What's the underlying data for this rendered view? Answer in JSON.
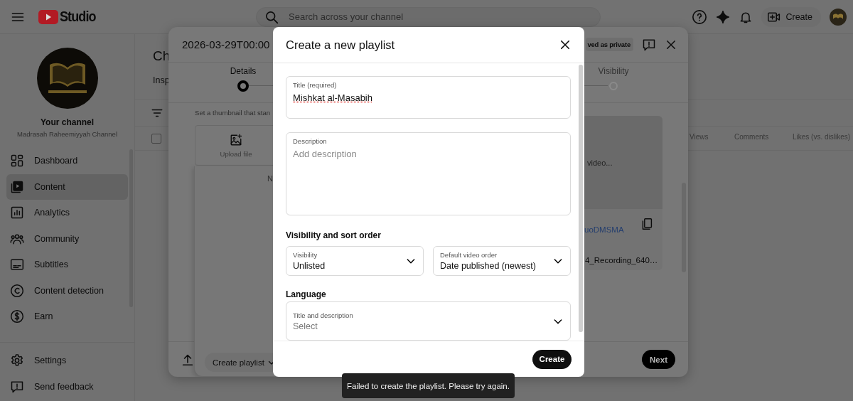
{
  "header": {
    "logo_text": "Studio",
    "search": {
      "placeholder": "Search across your channel"
    },
    "create_button": "Create"
  },
  "sidebar": {
    "channel_label": "Your channel",
    "channel_name": "Madrasah Raheemiyyah Channel",
    "items": [
      {
        "label": "Dashboard",
        "kind": "dashboard",
        "selected": false
      },
      {
        "label": "Content",
        "kind": "content",
        "selected": true
      },
      {
        "label": "Analytics",
        "kind": "analytics",
        "selected": false
      },
      {
        "label": "Community",
        "kind": "community",
        "selected": false
      },
      {
        "label": "Subtitles",
        "kind": "subtitles",
        "selected": false
      },
      {
        "label": "Content detection",
        "kind": "copyright",
        "selected": false
      },
      {
        "label": "Earn",
        "kind": "earn",
        "selected": false
      }
    ],
    "footer_items": [
      {
        "label": "Settings",
        "kind": "settings"
      },
      {
        "label": "Send feedback",
        "kind": "feedback"
      }
    ]
  },
  "content": {
    "title": "Ch",
    "tab": "Insp",
    "select_all": {
      "checked": false
    },
    "columns": [
      "Views",
      "Comments",
      "Likes (vs. dislikes)"
    ]
  },
  "upload_dialog": {
    "title": "2026-03-29T00:00",
    "badge": "ved as private",
    "steps": [
      {
        "label": "Details",
        "selected": true
      },
      {
        "label": "Visibility",
        "selected": false
      }
    ],
    "thumbnail_hint": "Set a thumbnail that stan",
    "upload_tile": "Upload file",
    "panel_text": "N",
    "preview_status": "video...",
    "link": "uoDMSMA",
    "filename": "4_Recording_640…",
    "playlist_button": "Create playlist",
    "next_button": "Next"
  },
  "playlist_dialog": {
    "title": "Create a new playlist",
    "title_field": {
      "label": "Title (required)",
      "value": "Mishkat al-Masabih",
      "misspelled": true
    },
    "description_field": {
      "label": "Description",
      "placeholder": "Add description"
    },
    "sort_heading": "Visibility and sort order",
    "sort_selects": [
      {
        "label": "Visibility",
        "value": "Unlisted"
      },
      {
        "label": "Default video order",
        "value": "Date published (newest)"
      }
    ],
    "language_heading": "Language",
    "language_select": {
      "label": "Title and description",
      "placeholder": "Select"
    },
    "create_button": "Create"
  },
  "toast": "Failed to create the playlist. Please try again."
}
